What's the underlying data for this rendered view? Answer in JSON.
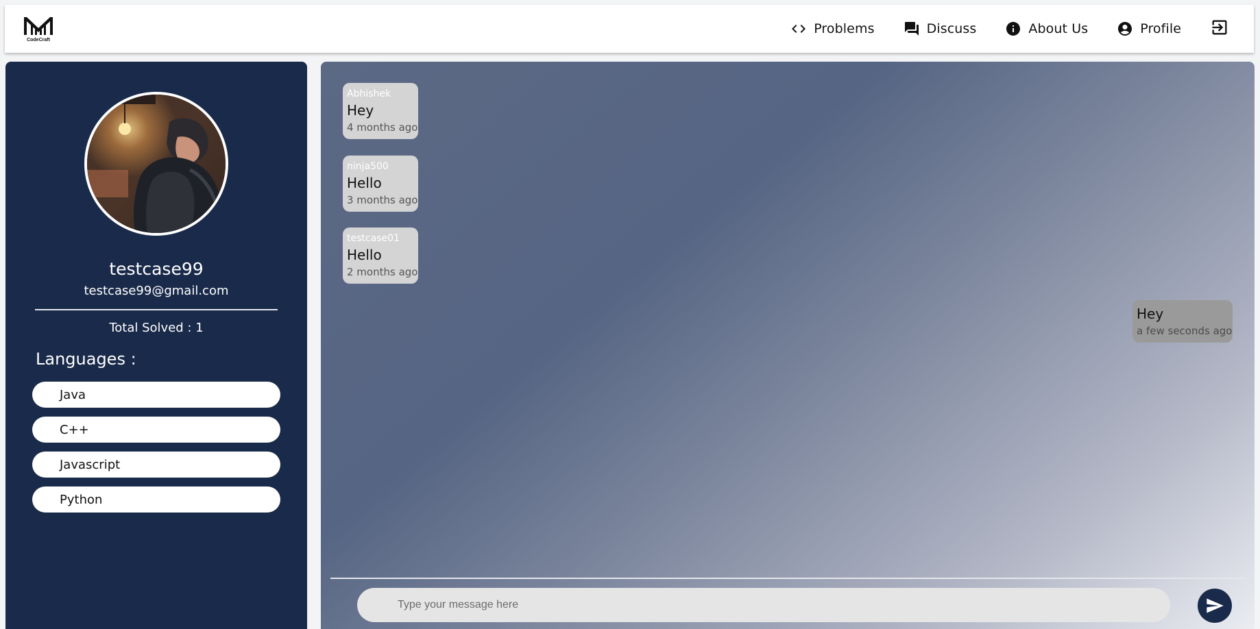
{
  "app": {
    "logo_text": "CodeCraft"
  },
  "nav": {
    "items": [
      {
        "label": "Problems",
        "icon": "code-icon"
      },
      {
        "label": "Discuss",
        "icon": "forum-icon"
      },
      {
        "label": "About Us",
        "icon": "info-icon"
      },
      {
        "label": "Profile",
        "icon": "account-circle-icon"
      }
    ],
    "logout_icon": "logout-icon"
  },
  "profile": {
    "username": "testcase99",
    "email": "testcase99@gmail.com",
    "total_solved_label": "Total Solved : 1",
    "languages_title": "Languages :",
    "languages": [
      "Java",
      "C++",
      "Javascript",
      "Python"
    ]
  },
  "chat": {
    "messages": [
      {
        "author": "Abhishek",
        "text": "Hey",
        "time": "4 months ago",
        "direction": "in"
      },
      {
        "author": "ninja500",
        "text": "Hello",
        "time": "3 months ago",
        "direction": "in"
      },
      {
        "author": "testcase01",
        "text": "Hello",
        "time": "2 months ago",
        "direction": "in"
      },
      {
        "author": "",
        "text": "Hey",
        "time": "a few seconds ago",
        "direction": "out"
      }
    ],
    "input_placeholder": "Type your message here",
    "input_value": ""
  },
  "colors": {
    "panel_navy": "#1a2a4a",
    "incoming_bubble": "#d4d4d4",
    "outgoing_bubble": "#9a9a9a"
  }
}
